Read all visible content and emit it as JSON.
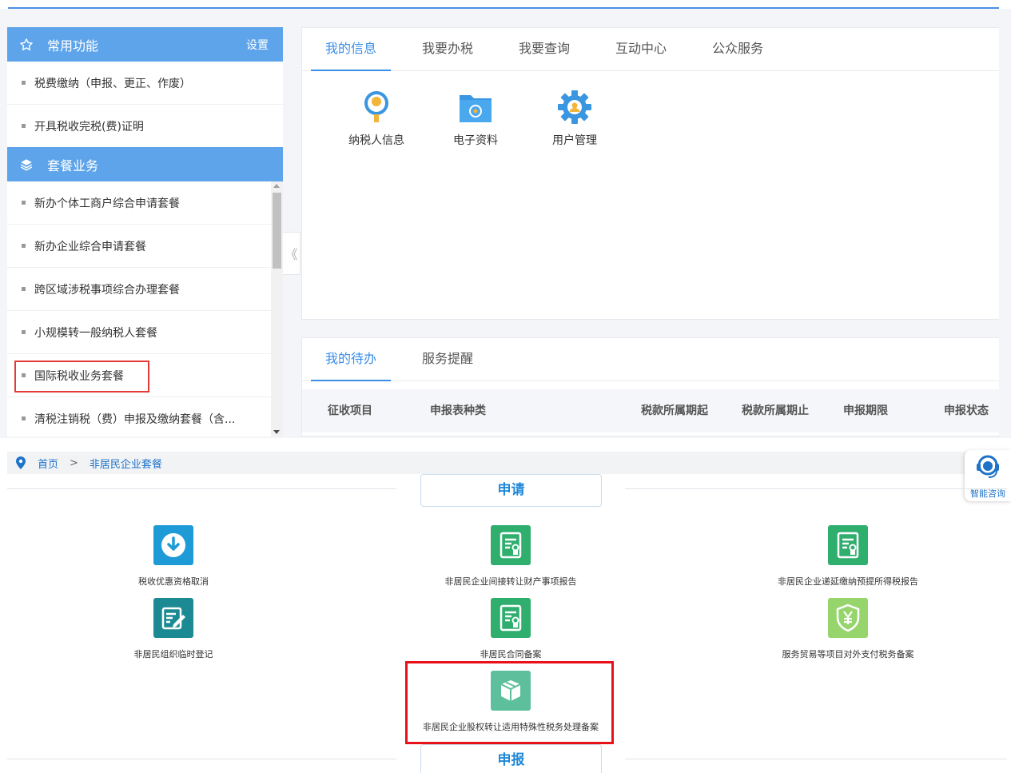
{
  "left_panel": {
    "common_title": "常用功能",
    "settings_label": "设置",
    "common_items": [
      "税费缴纳（申报、更正、作废）",
      "开具税收完税(费)证明"
    ],
    "package_title": "套餐业务",
    "package_items": [
      "新办个体工商户综合申请套餐",
      "新办企业综合申请套餐",
      "跨区域涉税事项综合办理套餐",
      "小规模转一般纳税人套餐",
      "国际税收业务套餐",
      "清税注销税（费）申报及缴纳套餐（含..."
    ]
  },
  "collapse_glyph": "《",
  "top_tabs": [
    "我的信息",
    "我要办税",
    "我要查询",
    "互动中心",
    "公众服务"
  ],
  "info_icons": [
    {
      "label": "纳税人信息",
      "icon": "taxpayer-info-icon"
    },
    {
      "label": "电子资料",
      "icon": "folder-icon"
    },
    {
      "label": "用户管理",
      "icon": "gear-icon"
    }
  ],
  "todo_tabs": [
    "我的待办",
    "服务提醒"
  ],
  "todo_columns": [
    "征收项目",
    "申报表种类",
    "税款所属期起",
    "税款所属期止",
    "申报期限",
    "申报状态"
  ],
  "breadcrumb": {
    "home": "首页",
    "separator": ">",
    "current": "非居民企业套餐"
  },
  "sections": {
    "apply": "申请",
    "declare": "申报"
  },
  "services": [
    {
      "label": "税收优惠资格取消",
      "icon": "download-icon",
      "color": "#1e9bd7"
    },
    {
      "label": "非居民企业间接转让财产事项报告",
      "icon": "report-icon",
      "color": "#2fae6e"
    },
    {
      "label": "非居民企业递延缴纳预提所得税报告",
      "icon": "report-icon",
      "color": "#2fae6e"
    },
    {
      "label": "非居民组织临时登记",
      "icon": "edit-icon",
      "color": "#1c8a93"
    },
    {
      "label": "非居民合同备案",
      "icon": "report-icon",
      "color": "#2fae6e"
    },
    {
      "label": "服务贸易等项目对外支付税务备案",
      "icon": "yen-shield-icon",
      "color": "#95d56b"
    },
    {
      "label": "非居民企业股权转让适用特殊性税务处理备案",
      "icon": "box-icon",
      "color": "#5dbf9b"
    }
  ],
  "assistant": {
    "label": "智能咨询"
  },
  "colors": {
    "accent": "#5ea4ea",
    "highlight": "#e8121a",
    "link": "#1e73c8"
  }
}
